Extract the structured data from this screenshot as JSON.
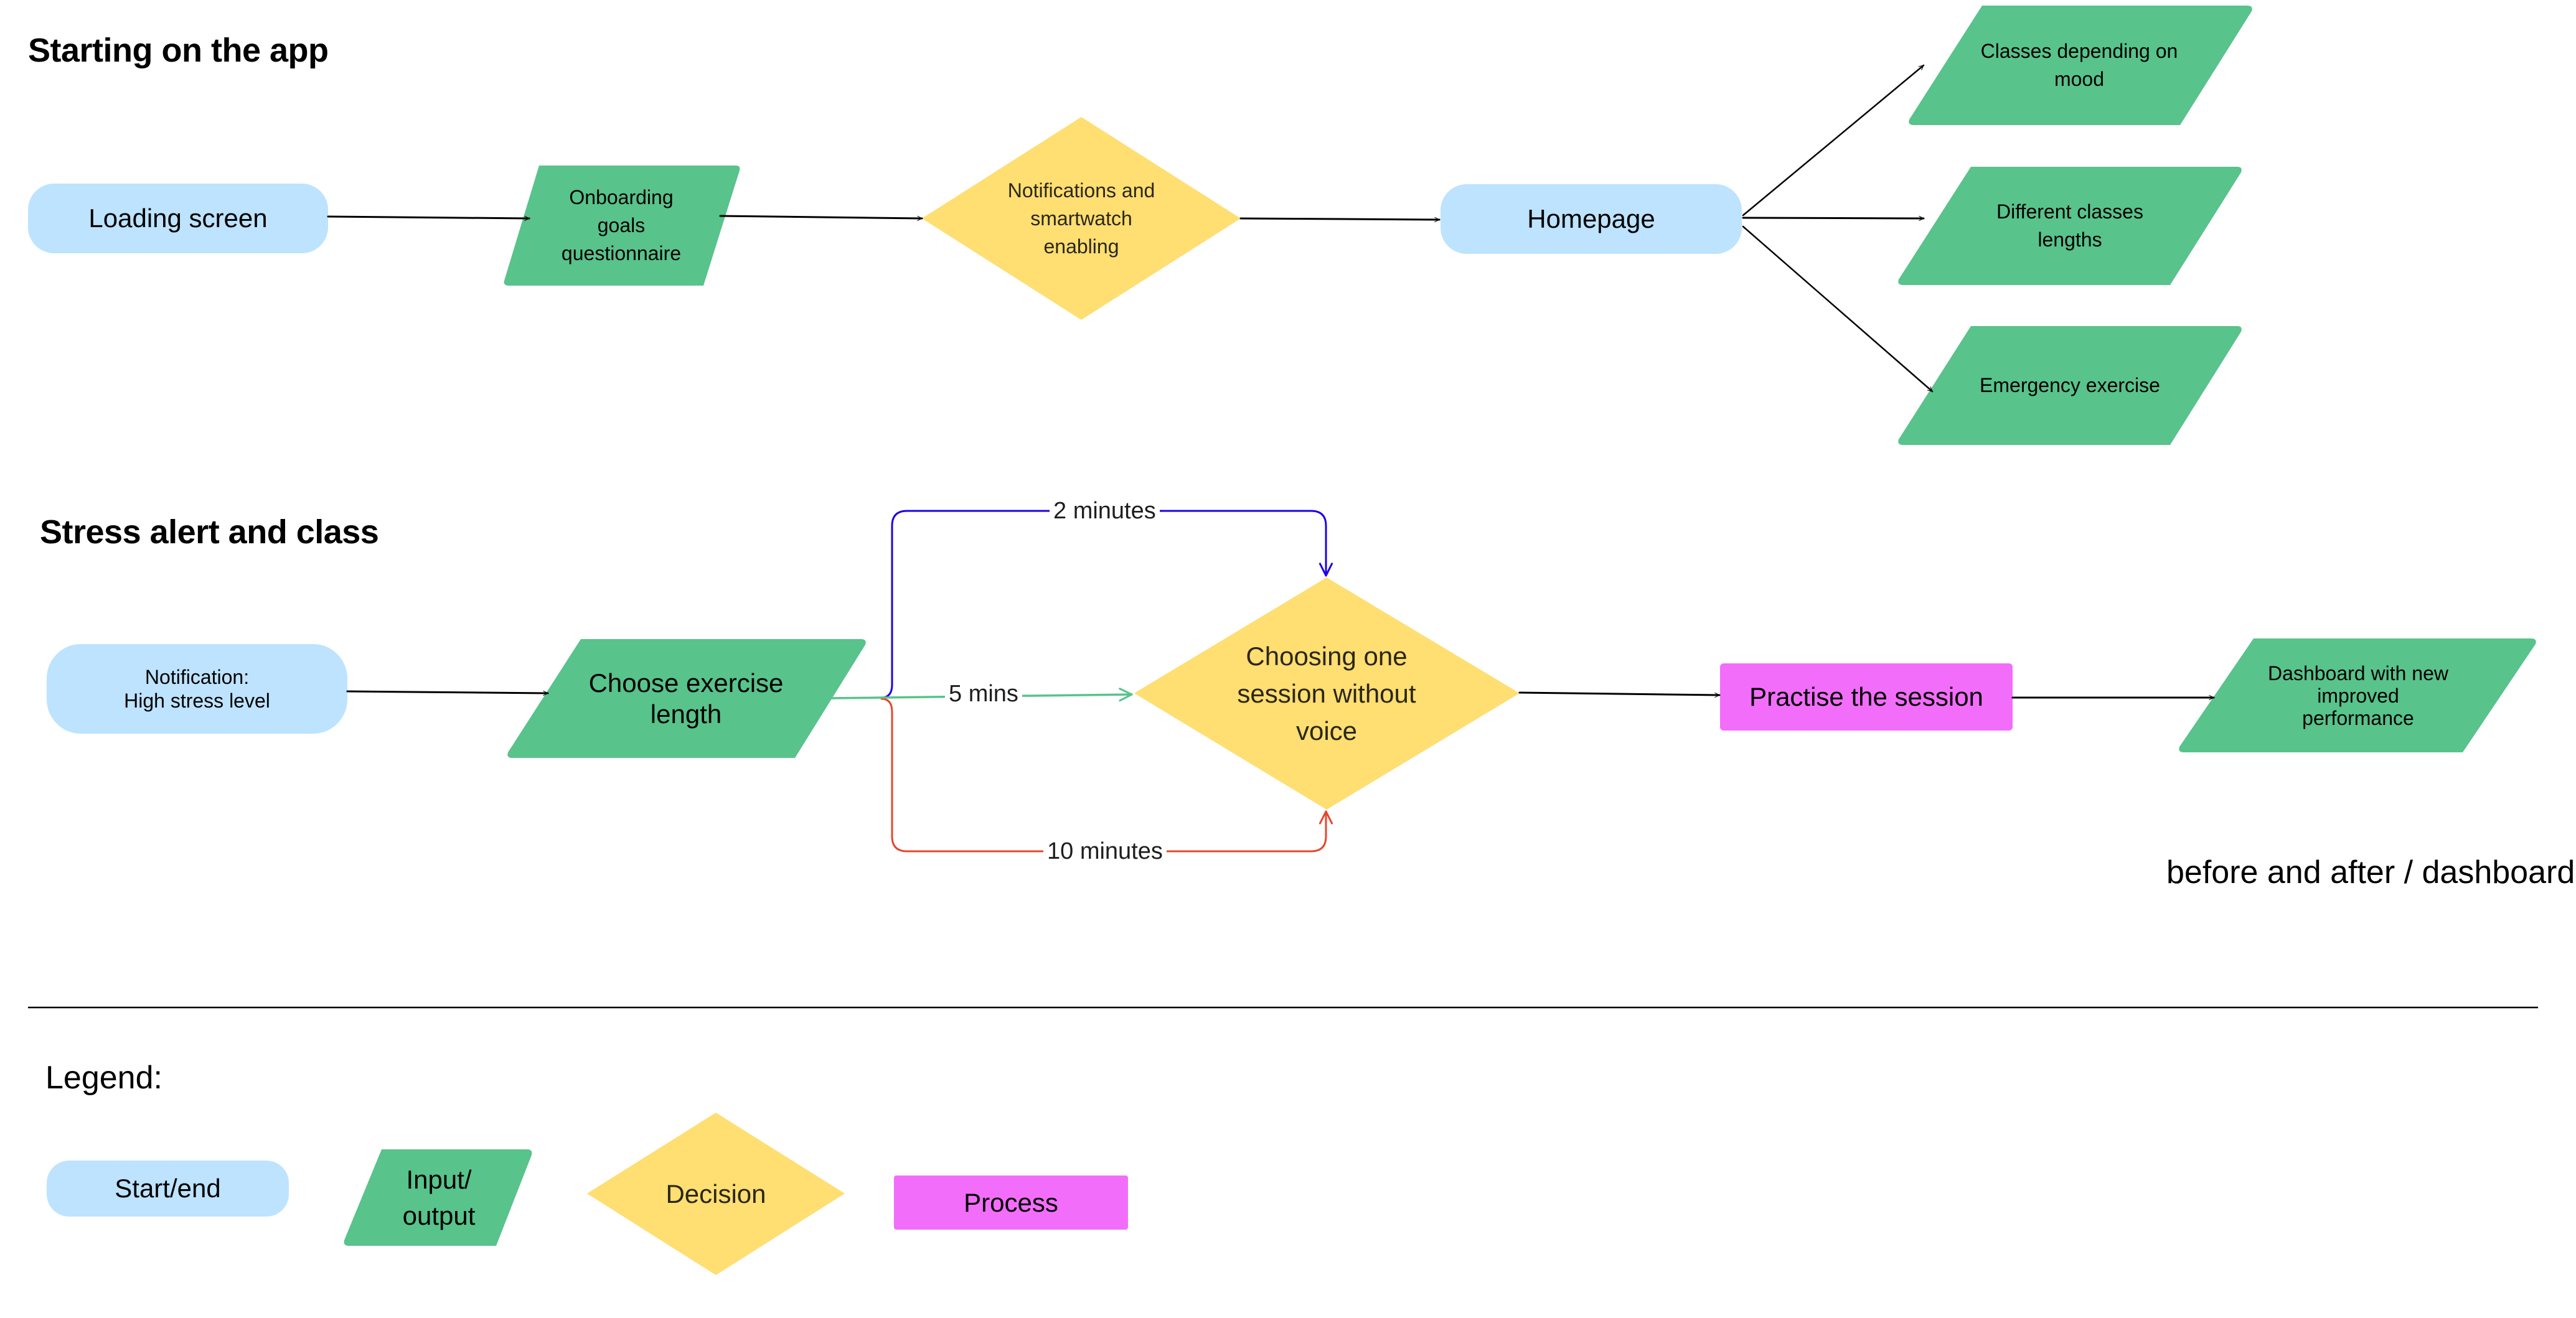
{
  "sections": {
    "start": {
      "title": "Starting on the app"
    },
    "stress": {
      "title": "Stress alert and class"
    },
    "legend": {
      "title": "Legend:"
    }
  },
  "colors": {
    "start_end": "#BDE3FF",
    "input_output": "#58C38B",
    "decision": "#FFDE72",
    "process": "#F36DFB",
    "path_2min": "#1F00E6",
    "path_5min": "#58C38B",
    "path_10min": "#E5472C"
  },
  "flow1": {
    "loading": {
      "type": "start_end",
      "label": "Loading screen"
    },
    "onboarding": {
      "type": "input_output",
      "label": "Onboarding\ngoals\nquestionnaire"
    },
    "notifications": {
      "type": "decision",
      "label": "Notifications and\nsmartwatch\nenabling"
    },
    "homepage": {
      "type": "start_end",
      "label": "Homepage"
    },
    "classes_mood": {
      "type": "input_output",
      "label": "Classes depending on\nmood"
    },
    "classes_lengths": {
      "type": "input_output",
      "label": "Different classes\nlengths"
    },
    "emergency": {
      "type": "input_output",
      "label": "Emergency exercise"
    }
  },
  "flow2": {
    "notification": {
      "type": "start_end",
      "label": "Notification:\nHigh stress level"
    },
    "choose_length": {
      "type": "input_output",
      "label": "Choose exercise\nlength"
    },
    "edges": {
      "two_min": "2 minutes",
      "five_min": "5 mins",
      "ten_min": "10 minutes"
    },
    "choosing_session": {
      "type": "decision",
      "label": "Choosing one\nsession without\nvoice"
    },
    "practise": {
      "type": "process",
      "label": "Practise the session"
    },
    "dashboard": {
      "type": "input_output",
      "label": "Dashboard with new\nimproved\nperformance"
    },
    "note": "before and after / dashboard"
  },
  "legend": {
    "items": [
      {
        "type": "start_end",
        "label": "Start/end"
      },
      {
        "type": "input_output",
        "label": "Input/\noutput"
      },
      {
        "type": "decision",
        "label": "Decision"
      },
      {
        "type": "process",
        "label": "Process"
      }
    ]
  }
}
